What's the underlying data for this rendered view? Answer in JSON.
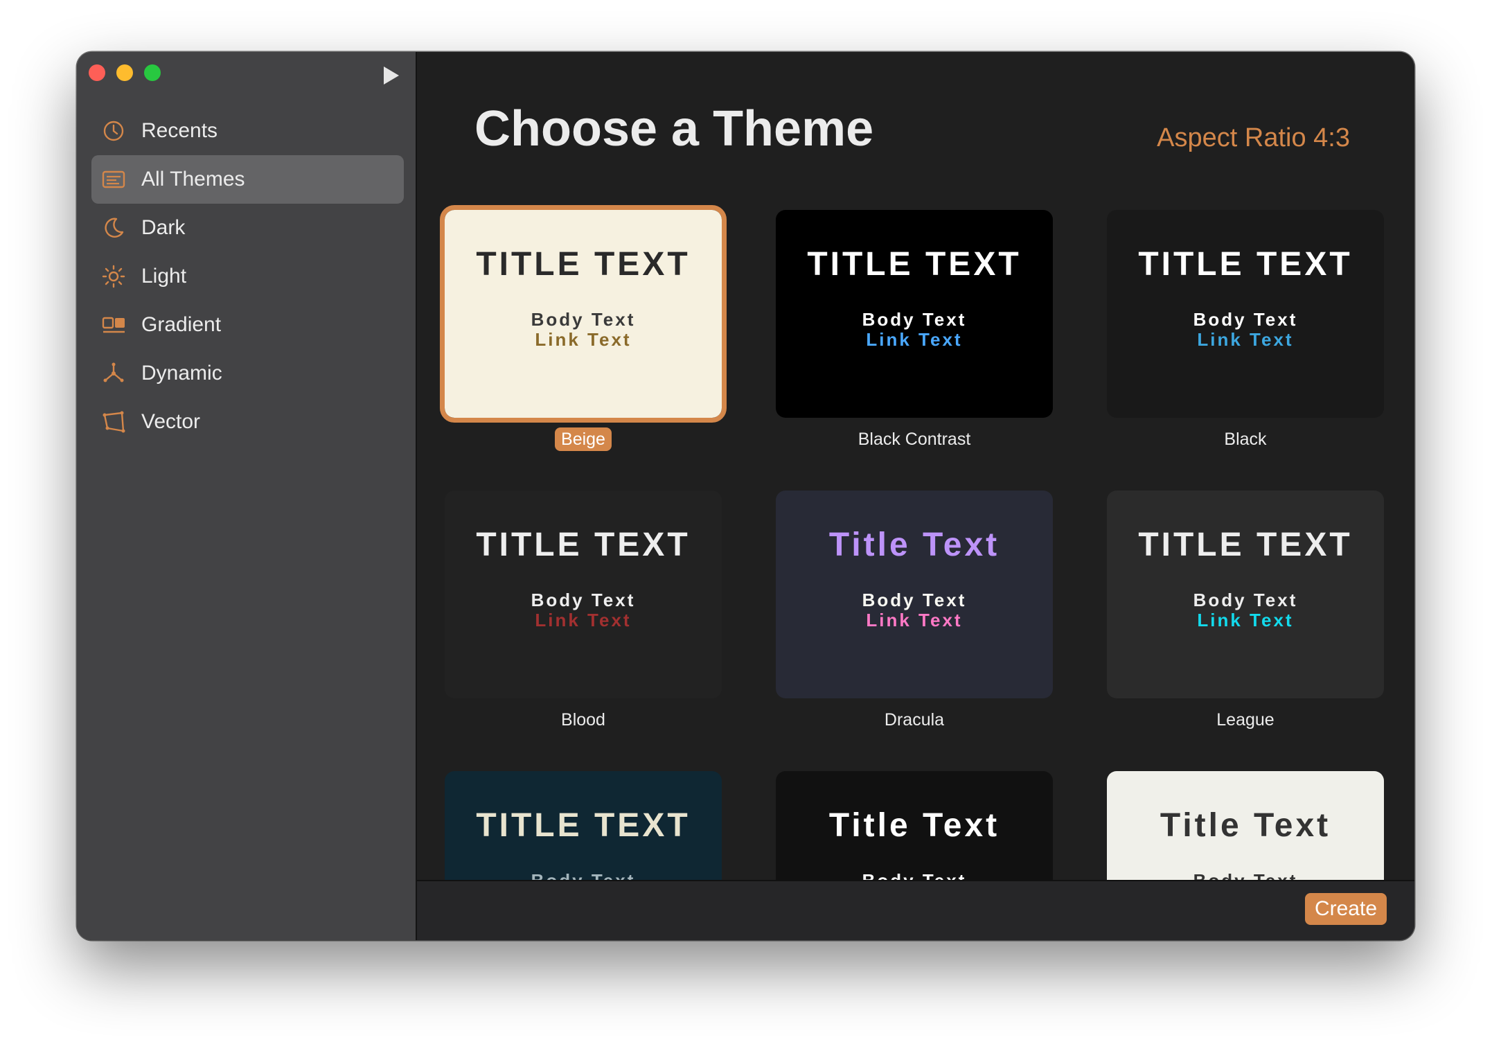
{
  "sidebar": {
    "items": [
      {
        "label": "Recents",
        "icon": "clock-icon"
      },
      {
        "label": "All Themes",
        "icon": "themes-icon",
        "selected": true
      },
      {
        "label": "Dark",
        "icon": "moon-icon"
      },
      {
        "label": "Light",
        "icon": "sun-icon"
      },
      {
        "label": "Gradient",
        "icon": "gradient-icon"
      },
      {
        "label": "Dynamic",
        "icon": "dynamic-icon"
      },
      {
        "label": "Vector",
        "icon": "vector-icon"
      }
    ]
  },
  "header": {
    "title": "Choose a Theme",
    "aspect_ratio": "Aspect Ratio 4:3"
  },
  "themes": [
    {
      "name": "Beige",
      "title": "TITLE TEXT",
      "body": "Body Text",
      "link": "Link Text",
      "bg": "#f6f1e0",
      "title_color": "#2a2a2a",
      "body_color": "#3a3a3a",
      "link_color": "#8a6a2a",
      "selected": true
    },
    {
      "name": "Black Contrast",
      "title": "TITLE TEXT",
      "body": "Body Text",
      "link": "Link Text",
      "bg": "#000000",
      "title_color": "#ffffff",
      "body_color": "#ffffff",
      "link_color": "#4aa8ff"
    },
    {
      "name": "Black",
      "title": "TITLE TEXT",
      "body": "Body Text",
      "link": "Link Text",
      "bg": "#191919",
      "title_color": "#ffffff",
      "body_color": "#ffffff",
      "link_color": "#3da7e0"
    },
    {
      "name": "Blood",
      "title": "TITLE TEXT",
      "body": "Body Text",
      "link": "Link Text",
      "bg": "#222222",
      "title_color": "#eeeeee",
      "body_color": "#eeeeee",
      "link_color": "#a23030"
    },
    {
      "name": "Dracula",
      "title": "Title Text",
      "body": "Body Text",
      "link": "Link Text",
      "bg": "#282a36",
      "title_color": "#bd93f9",
      "body_color": "#f8f8f2",
      "link_color": "#ff79c6"
    },
    {
      "name": "League",
      "title": "TITLE TEXT",
      "body": "Body Text",
      "link": "Link Text",
      "bg": "#2b2b2b",
      "title_color": "#eeeeee",
      "body_color": "#eeeeee",
      "link_color": "#13daec"
    },
    {
      "name": "",
      "title": "TITLE TEXT",
      "body": "Body Text",
      "link": "",
      "bg": "#0f2733",
      "title_color": "#e8e4cf",
      "body_color": "#a5b6bd",
      "link_color": "#a5b6bd"
    },
    {
      "name": "",
      "title": "Title Text",
      "body": "Body Text",
      "link": "",
      "bg": "#111111",
      "title_color": "#ffffff",
      "body_color": "#ffffff",
      "link_color": "#ffffff"
    },
    {
      "name": "",
      "title": "Title Text",
      "body": "Body Text",
      "link": "",
      "bg": "#f0f0ea",
      "title_color": "#333333",
      "body_color": "#333333",
      "link_color": "#333333"
    }
  ],
  "footer": {
    "create_label": "Create"
  },
  "colors": {
    "accent": "#d4874a"
  }
}
